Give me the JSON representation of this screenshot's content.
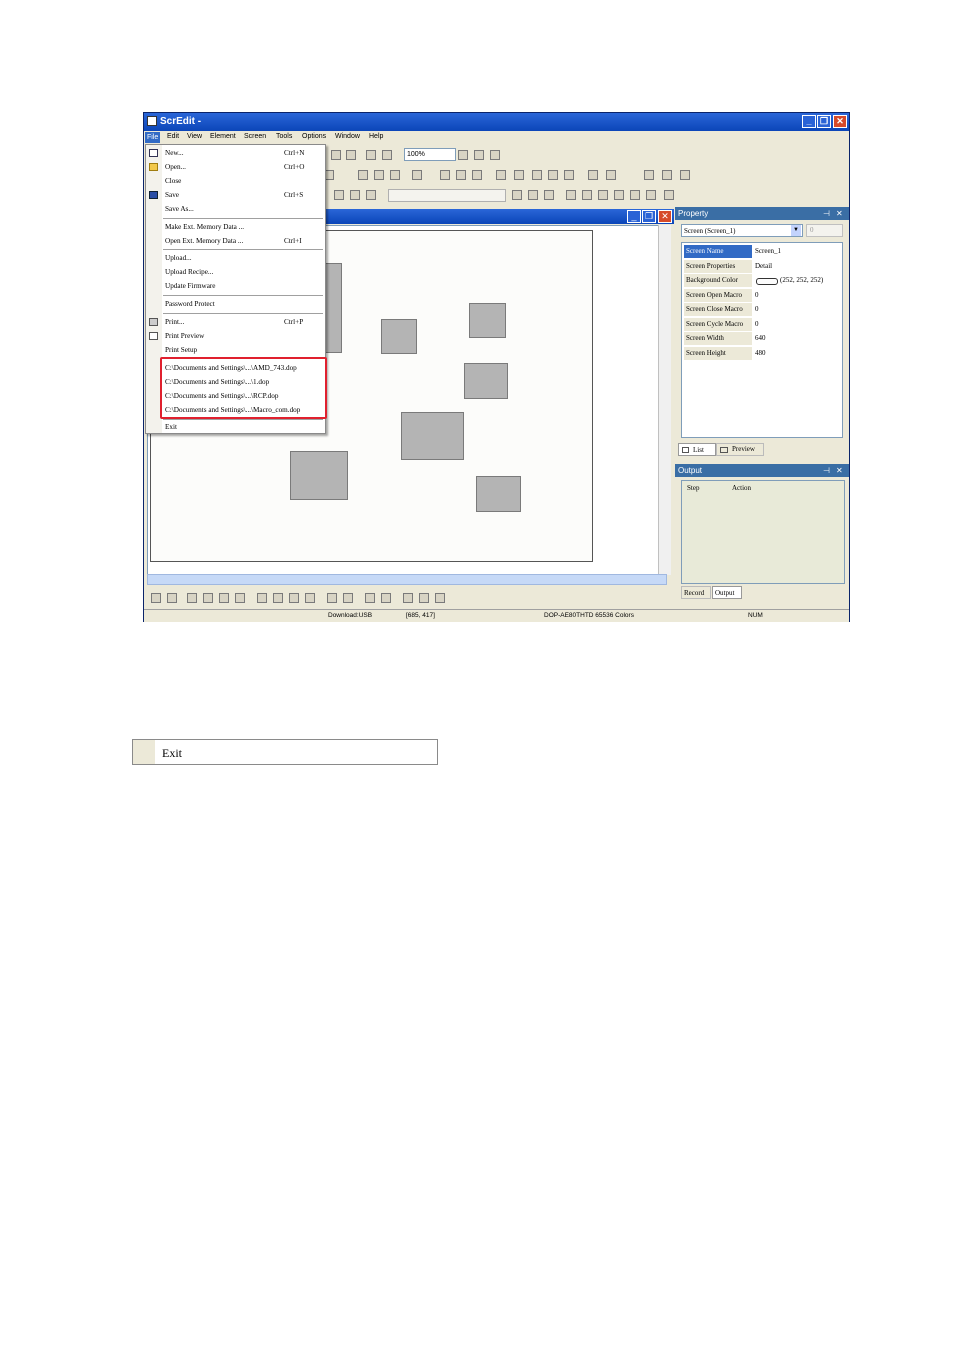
{
  "window": {
    "title": "ScrEdit -",
    "controls": {
      "minimize": "_",
      "restore": "❐",
      "close": "✕"
    }
  },
  "menubar": {
    "items": [
      "File",
      "Edit",
      "View",
      "Element",
      "Screen",
      "Tools",
      "Options",
      "Window",
      "Help"
    ]
  },
  "toolbar": {
    "zoom_value": "100%"
  },
  "file_menu": {
    "items": [
      {
        "label": "New...",
        "shortcut": "Ctrl+N",
        "icon": "new-file-icon"
      },
      {
        "label": "Open...",
        "shortcut": "Ctrl+O",
        "icon": "open-folder-icon"
      },
      {
        "label": "Close",
        "shortcut": ""
      },
      {
        "label": "Save",
        "shortcut": "Ctrl+S",
        "icon": "save-disk-icon"
      },
      {
        "label": "Save As...",
        "shortcut": ""
      },
      {
        "label": "Make Ext. Memory Data ...",
        "shortcut": ""
      },
      {
        "label": "Open Ext. Memory Data ...",
        "shortcut": "Ctrl+I"
      },
      {
        "label": "Upload...",
        "shortcut": ""
      },
      {
        "label": "Upload Recipe...",
        "shortcut": ""
      },
      {
        "label": "Update Firmware",
        "shortcut": ""
      },
      {
        "label": "Password Protect",
        "shortcut": ""
      },
      {
        "label": "Print...",
        "shortcut": "Ctrl+P",
        "icon": "printer-icon"
      },
      {
        "label": "Print Preview",
        "shortcut": "",
        "icon": "print-preview-icon"
      },
      {
        "label": "Print Setup",
        "shortcut": ""
      }
    ],
    "recent_files": [
      "C:\\Documents and Settings\\...\\AMD_743.dop",
      "C:\\Documents and Settings\\...\\1.dop",
      "C:\\Documents and Settings\\...\\RCP.dop",
      "C:\\Documents and Settings\\...\\Macro_com.dop"
    ],
    "exit_label": "Exit"
  },
  "property_panel": {
    "title": "Property",
    "selector": "Screen (Screen_1)",
    "selector_num": "0",
    "rows": [
      {
        "name": "Screen Name",
        "value": "Screen_1"
      },
      {
        "name": "Screen Properties",
        "value": "Detail"
      },
      {
        "name": "Background Color",
        "value": "(252, 252, 252)"
      },
      {
        "name": "Screen Open Macro",
        "value": "0"
      },
      {
        "name": "Screen Close Macro",
        "value": "0"
      },
      {
        "name": "Screen Cycle Macro",
        "value": "0"
      },
      {
        "name": "Screen Width",
        "value": "640"
      },
      {
        "name": "Screen Height",
        "value": "480"
      }
    ],
    "tabs": [
      "List",
      "Preview"
    ]
  },
  "output_panel": {
    "title": "Output",
    "columns": [
      "Step",
      "Action"
    ],
    "tabs": [
      "Record",
      "Output"
    ]
  },
  "status_bar": {
    "mode": "Download:USB",
    "coords": "[685, 417]",
    "device": "DOP-AE80THTD 65536 Colors",
    "num": "NUM"
  },
  "exit_sample": {
    "label": "Exit"
  },
  "colors": {
    "highlight_box": "#e0202e",
    "title_blue": "#0b45b8",
    "selected_row": "#316ac5"
  }
}
